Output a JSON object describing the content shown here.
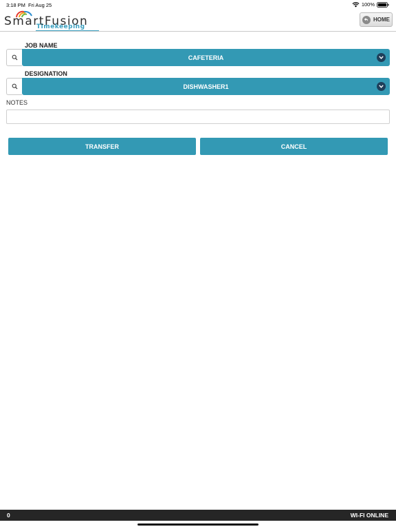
{
  "status_bar": {
    "time": "3:18 PM",
    "date": "Fri Aug 25",
    "battery": "100%",
    "icons": [
      "wifi-icon",
      "battery-icon"
    ]
  },
  "header": {
    "logo_main": "SmartFusion",
    "logo_sub": "Timekeeping",
    "home_label": "HOME",
    "home_icon": "back-arrow-icon"
  },
  "form": {
    "job_name": {
      "label": "JOB NAME",
      "value": "CAFETERIA",
      "search_icon": "search-icon"
    },
    "designation": {
      "label": "DESIGNATION",
      "value": "DISHWASHER1",
      "search_icon": "search-icon"
    },
    "notes": {
      "label": "NOTES",
      "value": "",
      "placeholder": ""
    }
  },
  "actions": {
    "transfer_label": "TRANSFER",
    "cancel_label": "CANCEL"
  },
  "footer": {
    "count": "0",
    "connection": "WI-FI ONLINE"
  },
  "colors": {
    "accent": "#3399b4",
    "chevron_bg": "#1e3f5a",
    "footer_bg": "#262626",
    "logo_sub": "#3a9fbf"
  }
}
